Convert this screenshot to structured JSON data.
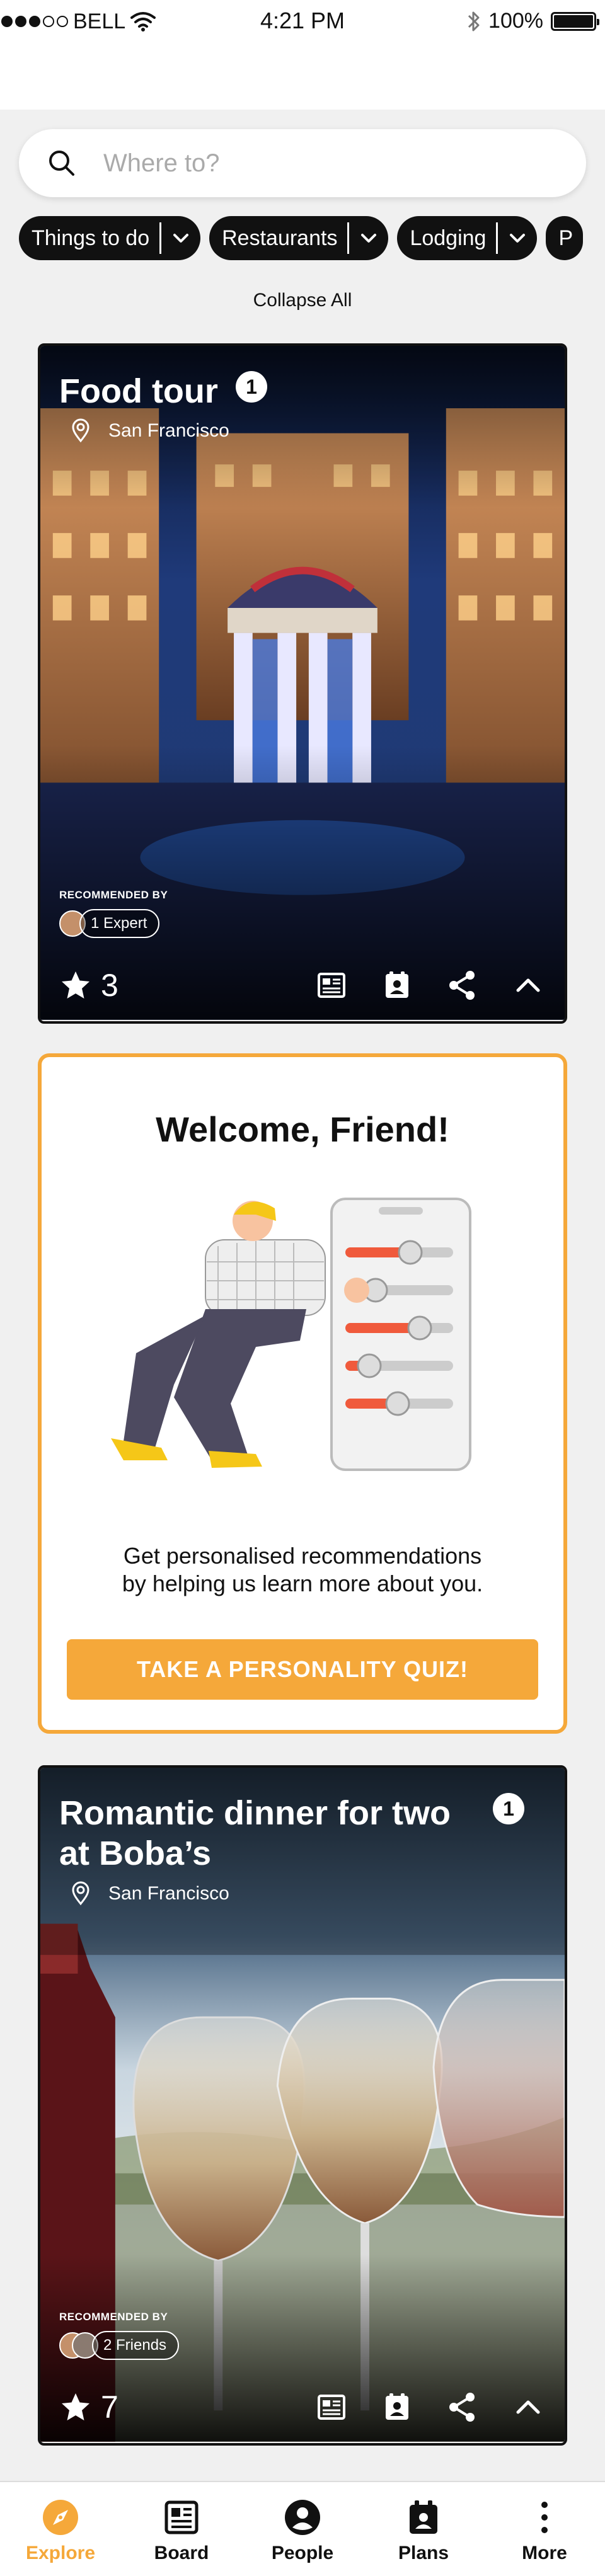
{
  "status": {
    "carrier": "BELL",
    "time": "4:21 PM",
    "battery": "100%",
    "battery_level": 1.0
  },
  "search": {
    "placeholder": "Where to?",
    "icon": "search-icon"
  },
  "filters": [
    {
      "label": "Things to do"
    },
    {
      "label": "Restaurants"
    },
    {
      "label": "Lodging"
    },
    {
      "label": "P"
    }
  ],
  "collapse_label": "Collapse All",
  "cards": [
    {
      "title": "Food tour",
      "badge": "1",
      "location": "San Francisco",
      "recommended_label": "RECOMMENDED BY",
      "recommended_by": "1 Expert",
      "rating": "3"
    },
    {
      "title": "Romantic dinner for two at Boba’s",
      "badge": "1",
      "location": "San Francisco",
      "recommended_label": "RECOMMENDED BY",
      "recommended_by": "2 Friends",
      "rating": "7"
    }
  ],
  "welcome": {
    "title": "Welcome, Friend!",
    "text_line1": "Get personalised recommendations",
    "text_line2": "by helping us learn more about you.",
    "button": "TAKE A PERSONALITY QUIZ!"
  },
  "tabs": [
    {
      "label": "Explore",
      "icon": "compass-icon",
      "active": true
    },
    {
      "label": "Board",
      "icon": "board-icon"
    },
    {
      "label": "People",
      "icon": "person-icon"
    },
    {
      "label": "Plans",
      "icon": "plans-icon"
    },
    {
      "label": "More",
      "icon": "more-icon"
    }
  ],
  "colors": {
    "accent": "#f5a83a",
    "dark": "#111111"
  }
}
